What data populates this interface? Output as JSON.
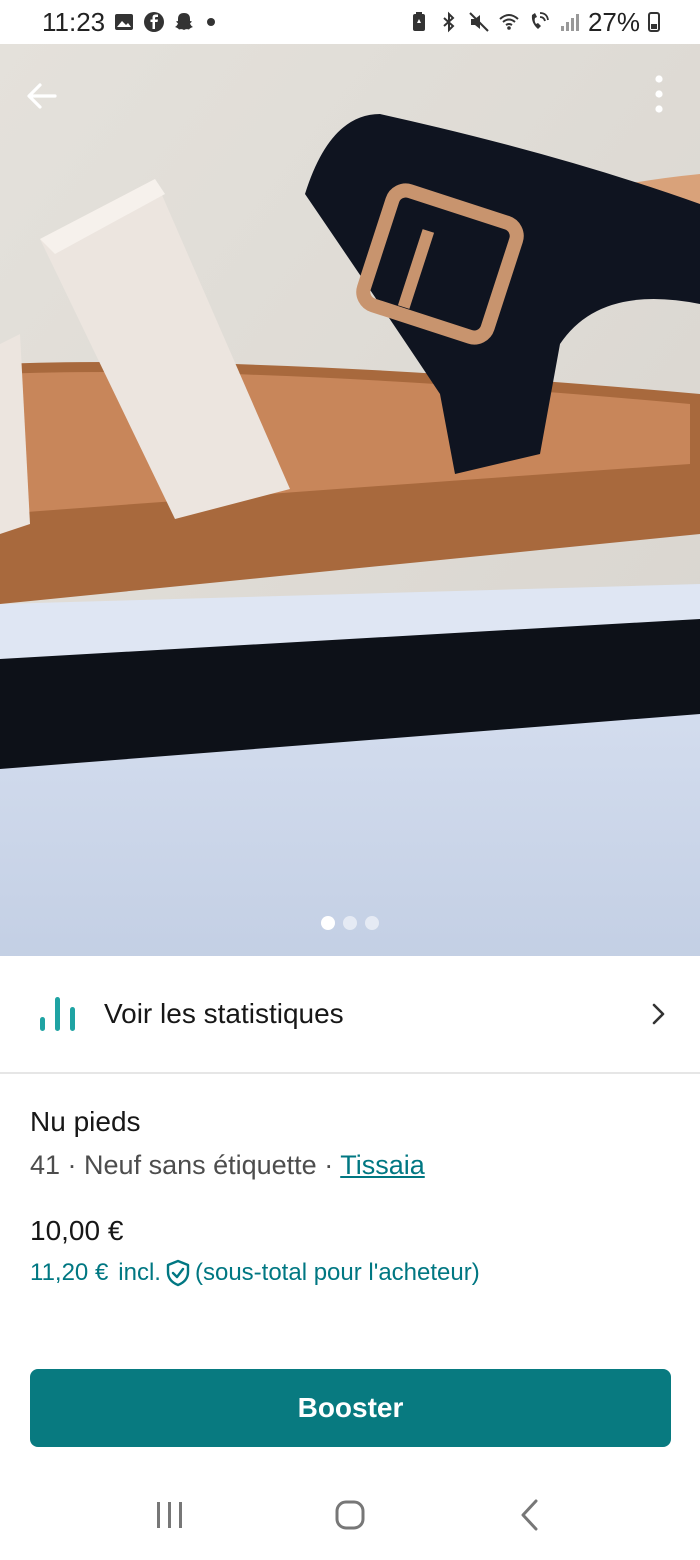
{
  "status_bar": {
    "time": "11:23",
    "battery_percent": "27%",
    "left_icons": [
      "gallery-icon",
      "facebook-icon",
      "snapchat-icon",
      "notification-dot-icon"
    ],
    "right_icons": [
      "battery-saver-icon",
      "bluetooth-icon",
      "mute-icon",
      "wifi-icon",
      "wifi-call-icon",
      "signal-icon",
      "battery-icon"
    ]
  },
  "photo": {
    "image_count": 3,
    "active_index": 0
  },
  "stats": {
    "label": "Voir les statistiques"
  },
  "item": {
    "title": "Nu pieds",
    "size": "41",
    "separator": " · ",
    "condition": "Neuf sans étiquette",
    "brand": "Tissaia",
    "price": "10,00 €",
    "buyer_price": "11,20 €",
    "incl_label": "incl.",
    "buyer_note": "(sous-total pour l'acheteur)"
  },
  "actions": {
    "boost_label": "Booster"
  },
  "colors": {
    "accent": "#007782",
    "button": "#087a80"
  }
}
